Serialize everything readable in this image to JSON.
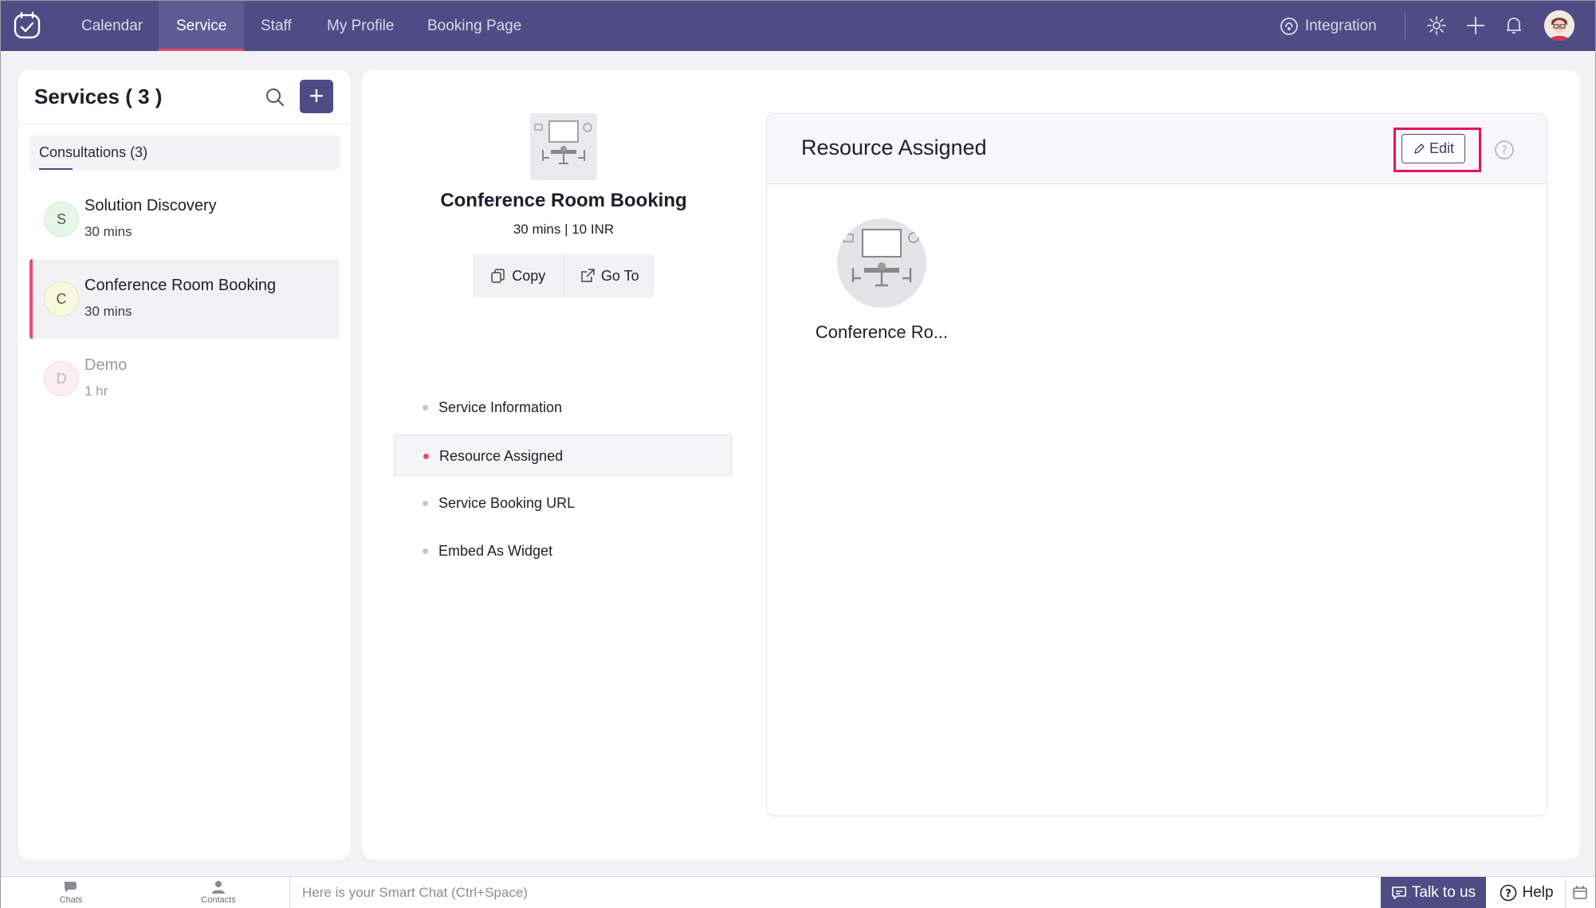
{
  "app": {
    "nav": {
      "items": [
        {
          "label": "Calendar"
        },
        {
          "label": "Service",
          "active": true
        },
        {
          "label": "Staff"
        },
        {
          "label": "My Profile"
        },
        {
          "label": "Booking Page"
        }
      ],
      "integration_label": "Integration",
      "icons": [
        "settings-icon",
        "plus-icon",
        "bell-icon"
      ]
    },
    "colors": {
      "header": "#4f4c85",
      "accent": "#e94a6c",
      "highlight": "#e3135a"
    }
  },
  "services_panel": {
    "title": "Services ( 3 )",
    "add_label": "+",
    "category_tab": "Consultations (3)",
    "items": [
      {
        "letter": "S",
        "name": "Solution Discovery",
        "duration": "30 mins",
        "color": "#e7f7e7"
      },
      {
        "letter": "C",
        "name": "Conference Room Booking",
        "duration": "30 mins",
        "color": "#f6f9dc",
        "active": true
      },
      {
        "letter": "D",
        "name": "Demo",
        "duration": "1 hr",
        "color": "#fdeef4"
      }
    ]
  },
  "service_detail": {
    "title": "Conference Room Booking",
    "meta": "30 mins | 10 INR",
    "copy_label": "Copy",
    "goto_label": "Go To",
    "menu": [
      {
        "label": "Service Information"
      },
      {
        "label": "Resource Assigned",
        "active": true
      },
      {
        "label": "Service Booking URL"
      },
      {
        "label": "Embed As Widget"
      }
    ]
  },
  "resource_card": {
    "title": "Resource Assigned",
    "edit_label": "Edit",
    "resource_name": "Conference Ro..."
  },
  "bottom_bar": {
    "chats_label": "Chats",
    "contacts_label": "Contacts",
    "smart_chat_placeholder": "Here is your Smart Chat (Ctrl+Space)",
    "talk_label": "Talk to us",
    "help_label": "Help"
  }
}
